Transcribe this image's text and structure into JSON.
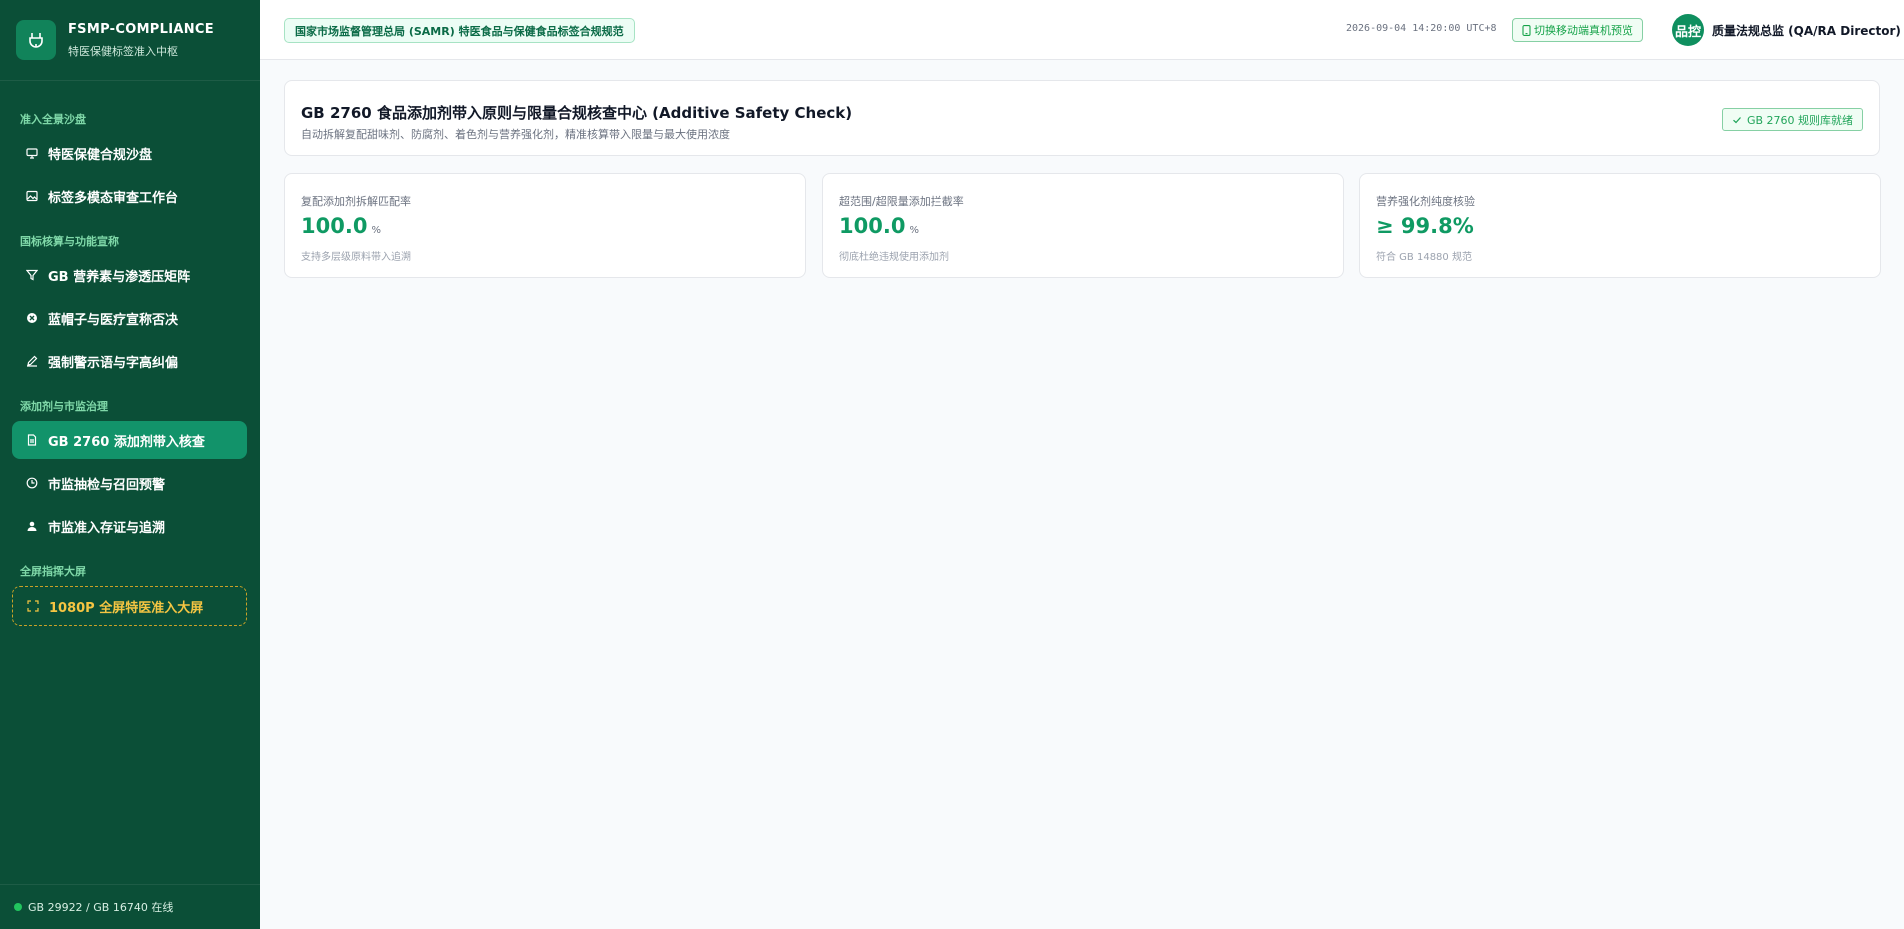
{
  "brand": {
    "title": "FSMP-COMPLIANCE",
    "subtitle": "特医保健标签准入中枢"
  },
  "sidebar": {
    "groups": [
      {
        "label": "准入全景沙盘"
      },
      {
        "label": "国标核算与功能宣称"
      },
      {
        "label": "添加剂与市监治理"
      },
      {
        "label": "全屏指挥大屏"
      }
    ],
    "items": [
      {
        "label": "特医保健合规沙盘",
        "icon": "monitor-icon"
      },
      {
        "label": "标签多模态审查工作台",
        "icon": "image-icon"
      },
      {
        "label": "GB 营养素与渗透压矩阵",
        "icon": "filter-icon"
      },
      {
        "label": "蓝帽子与医疗宣称否决",
        "icon": "x-circle-icon"
      },
      {
        "label": "强制警示语与字高纠偏",
        "icon": "pen-icon"
      },
      {
        "label": "GB 2760 添加剂带入核查",
        "icon": "document-icon",
        "active": true
      },
      {
        "label": "市监抽检与召回预警",
        "icon": "clock-icon"
      },
      {
        "label": "市监准入存证与追溯",
        "icon": "user-icon"
      },
      {
        "label": "1080P 全屏特医准入大屏",
        "icon": "fullscreen-icon"
      }
    ],
    "footer": "GB 29922 / GB 16740 在线"
  },
  "header": {
    "regulation": "国家市场监督管理总局 (SAMR) 特医食品与保健食品标签合规规范",
    "timestamp": "2026-09-04 14:20:00 UTC+8",
    "mobile_button": "切换移动端真机预览",
    "avatar_text": "品控",
    "user": "质量法规总监 (QA/RA Director)"
  },
  "main": {
    "title": "GB 2760 食品添加剂带入原则与限量合规核查中心 (Additive Safety Check)",
    "subtitle": "自动拆解复配甜味剂、防腐剂、着色剂与营养强化剂，精准核算带入限量与最大使用浓度",
    "ready_badge": "GB 2760 规则库就绪",
    "metrics": [
      {
        "label": "复配添加剂拆解匹配率",
        "value": "100.0",
        "unit": "%",
        "note": "支持多层级原料带入追溯"
      },
      {
        "label": "超范围/超限量添加拦截率",
        "value": "100.0",
        "unit": "%",
        "note": "彻底杜绝违规使用添加剂"
      },
      {
        "label": "营养强化剂纯度核验",
        "value": "≥ 99.8%",
        "unit": "",
        "note": "符合 GB 14880 规范"
      }
    ]
  },
  "colors": {
    "sidebar_bg": "#0b4f37",
    "accent": "#0f9a63",
    "active_item": "#12936a",
    "bigscreen": "#f5c542"
  }
}
